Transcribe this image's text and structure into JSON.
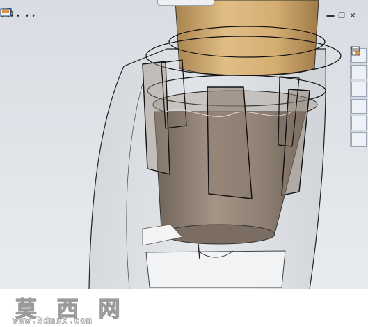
{
  "watermark": {
    "site_name": "莫 西 网",
    "url": "www.3dmox.com"
  },
  "toolbar": {
    "items": [
      "view-orientation-icon",
      "display-style-icon",
      "hide-show-icon",
      "appearance-icon",
      "scene-icon",
      "view-settings-icon"
    ]
  },
  "task_pane": {
    "items": [
      "home-icon",
      "resources-icon",
      "folder-icon",
      "file-explorer-icon",
      "appearances-icon",
      "custom-properties-icon"
    ]
  },
  "colors": {
    "viewport_bg": "#dfe3e8",
    "part_tan": "#c9a36a",
    "part_gray": "#8e7f73"
  }
}
